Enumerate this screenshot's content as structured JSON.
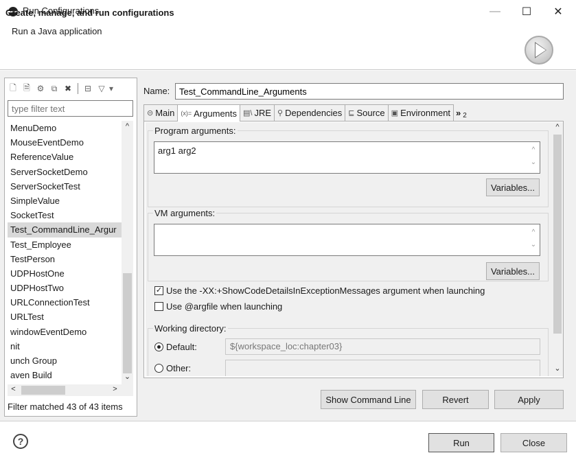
{
  "window": {
    "title": "Run Configurations",
    "minimize": "—",
    "maximize": "☐",
    "close": "✕"
  },
  "header": {
    "title": "Create, manage, and run configurations",
    "subtitle": "Run a Java application"
  },
  "left": {
    "filter_placeholder": "type filter text",
    "items": [
      "MenuDemo",
      "MouseEventDemo",
      "ReferenceValue",
      "ServerSocketDemo",
      "ServerSocketTest",
      "SimpleValue",
      "SocketTest",
      "Test_CommandLine_Argur",
      "Test_Employee",
      "TestPerson",
      "UDPHostOne",
      "UDPHostTwo",
      "URLConnectionTest",
      "URLTest",
      "windowEventDemo",
      "nit",
      "unch Group",
      "aven Build"
    ],
    "selected_index": 7,
    "status": "Filter matched 43 of 43 items"
  },
  "config": {
    "name_label": "Name:",
    "name_value": "Test_CommandLine_Arguments",
    "tabs": [
      {
        "icon": "⊝",
        "label": "Main"
      },
      {
        "icon": "(x)=",
        "label": "Arguments"
      },
      {
        "icon": "▤\\",
        "label": "JRE"
      },
      {
        "icon": "⚲",
        "label": "Dependencies"
      },
      {
        "icon": "⊑",
        "label": "Source"
      },
      {
        "icon": "▣",
        "label": "Environment"
      },
      {
        "icon": "»",
        "label": "2"
      }
    ],
    "active_tab": 1,
    "program_args_label": "Program arguments:",
    "program_args_value": "arg1 arg2",
    "variables_label_1": "Variables...",
    "vm_args_label": "VM arguments:",
    "vm_args_value": "",
    "variables_label_2": "Variables...",
    "check_details_label": "Use the -XX:+ShowCodeDetailsInExceptionMessages argument when launching",
    "check_details_checked": true,
    "check_argfile_label": "Use @argfile when launching",
    "check_argfile_checked": false,
    "working_dir_label": "Working directory:",
    "default_label": "Default:",
    "default_value": "${workspace_loc:chapter03}",
    "other_label": "Other:"
  },
  "actions": {
    "show_command_line": "Show Command Line",
    "revert": "Revert",
    "apply": "Apply",
    "run": "Run",
    "close": "Close"
  }
}
